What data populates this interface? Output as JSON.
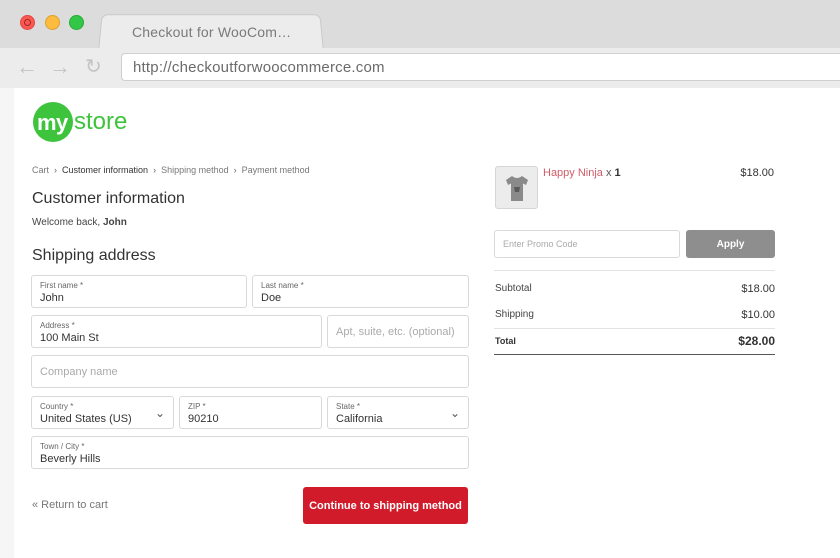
{
  "browser": {
    "tab_title": "Checkout for WooCom…",
    "url": "http://checkoutforwoocommerce.com",
    "back_icon": "back-arrow-icon",
    "forward_icon": "forward-arrow-icon",
    "reload_icon": "reload-icon"
  },
  "logo": {
    "my": "my",
    "store": "store",
    "brand_color": "#3ec43c"
  },
  "breadcrumbs": {
    "cart": "Cart",
    "customer_information": "Customer information",
    "shipping_method": "Shipping method",
    "payment_method": "Payment method",
    "separator": "›"
  },
  "customer": {
    "heading": "Customer information",
    "welcome_prefix": "Welcome back, ",
    "name": "John"
  },
  "shipping": {
    "heading": "Shipping address",
    "first_name": {
      "label": "First name *",
      "value": "John"
    },
    "last_name": {
      "label": "Last name *",
      "value": "Doe"
    },
    "address": {
      "label": "Address *",
      "value": "100 Main St"
    },
    "address2": {
      "placeholder": "Apt, suite, etc. (optional)"
    },
    "company": {
      "placeholder": "Company name"
    },
    "country": {
      "label": "Country *",
      "value": "United States (US)"
    },
    "zip": {
      "label": "ZIP *",
      "value": "90210"
    },
    "state": {
      "label": "State *",
      "value": "California"
    },
    "city": {
      "label": "Town / City *",
      "value": "Beverly Hills"
    }
  },
  "actions": {
    "return_label": "« Return to cart",
    "continue_label": "Continue to shipping method",
    "continue_color": "#d21b2a"
  },
  "order": {
    "product_name": "Happy Ninja",
    "product_qty_prefix": " x ",
    "product_qty": "1",
    "product_price": "$18.00",
    "promo_placeholder": "Enter Promo Code",
    "apply_label": "Apply",
    "subtotal_label": "Subtotal",
    "subtotal_value": "$18.00",
    "shipping_label": "Shipping",
    "shipping_value": "$10.00",
    "total_label": "Total",
    "total_value": "$28.00"
  }
}
